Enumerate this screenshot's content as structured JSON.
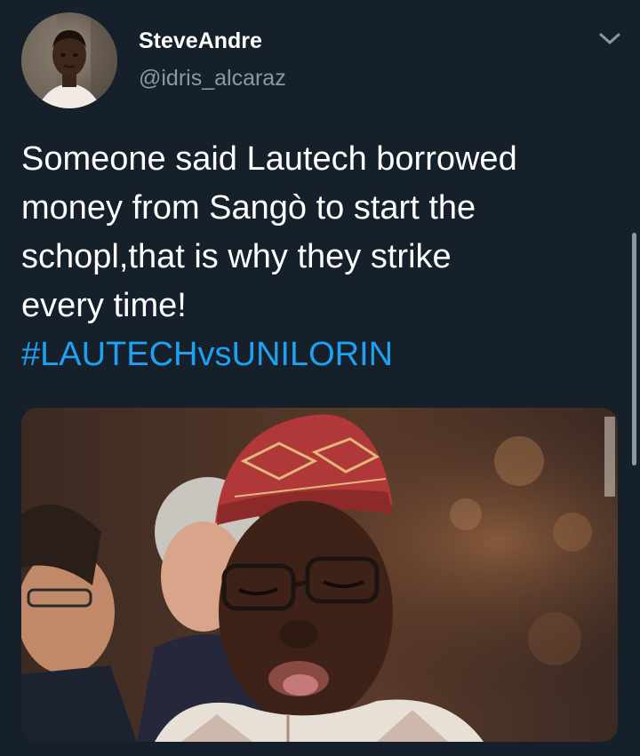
{
  "user": {
    "display_name": "SteveAndre",
    "handle": "@idris_alcaraz",
    "avatar_icon": "profile-photo"
  },
  "menu_icon": "chevron-down-icon",
  "tweet": {
    "text": "Someone said Lautech  borrowed\nmoney from Sangò to start the\nschopl,that is why they strike\nevery time!",
    "hashtag": "#LAUTECHvsUNILORIN"
  },
  "media": {
    "kind": "photo"
  },
  "colors": {
    "background": "#15202b",
    "text": "#ffffff",
    "secondary_text": "#8899a6",
    "link": "#1da1f2"
  }
}
